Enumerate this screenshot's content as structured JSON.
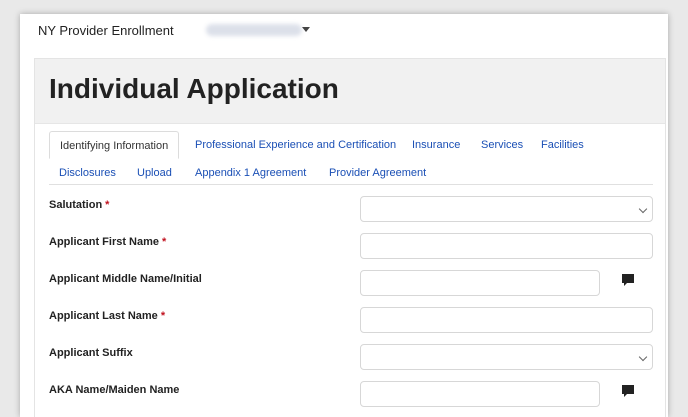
{
  "app": {
    "title": "NY Provider Enrollment"
  },
  "page": {
    "title": "Individual Application"
  },
  "tabs": [
    {
      "label": "Identifying Information",
      "active": true
    },
    {
      "label": "Professional Experience and Certification",
      "active": false
    },
    {
      "label": "Insurance",
      "active": false
    },
    {
      "label": "Services",
      "active": false
    },
    {
      "label": "Facilities",
      "active": false
    },
    {
      "label": "Disclosures",
      "active": false
    },
    {
      "label": "Upload",
      "active": false
    },
    {
      "label": "Appendix 1 Agreement",
      "active": false
    },
    {
      "label": "Provider Agreement",
      "active": false
    }
  ],
  "form": {
    "fields": [
      {
        "label": "Salutation",
        "required": "*",
        "type": "select",
        "value": ""
      },
      {
        "label": "Applicant First Name",
        "required": "*",
        "type": "text",
        "value": ""
      },
      {
        "label": "Applicant Middle Name/Initial",
        "required": "",
        "type": "text",
        "value": "",
        "comment_icon": "comment-icon"
      },
      {
        "label": "Applicant Last Name",
        "required": "*",
        "type": "text",
        "value": ""
      },
      {
        "label": "Applicant Suffix",
        "required": "",
        "type": "select",
        "value": ""
      },
      {
        "label": "AKA Name/Maiden Name",
        "required": "",
        "type": "text",
        "value": "",
        "comment_icon": "comment-icon"
      }
    ]
  },
  "colors": {
    "link": "#1a4fb5",
    "required": "#c1121f",
    "header_bg": "#f1f1f1"
  }
}
